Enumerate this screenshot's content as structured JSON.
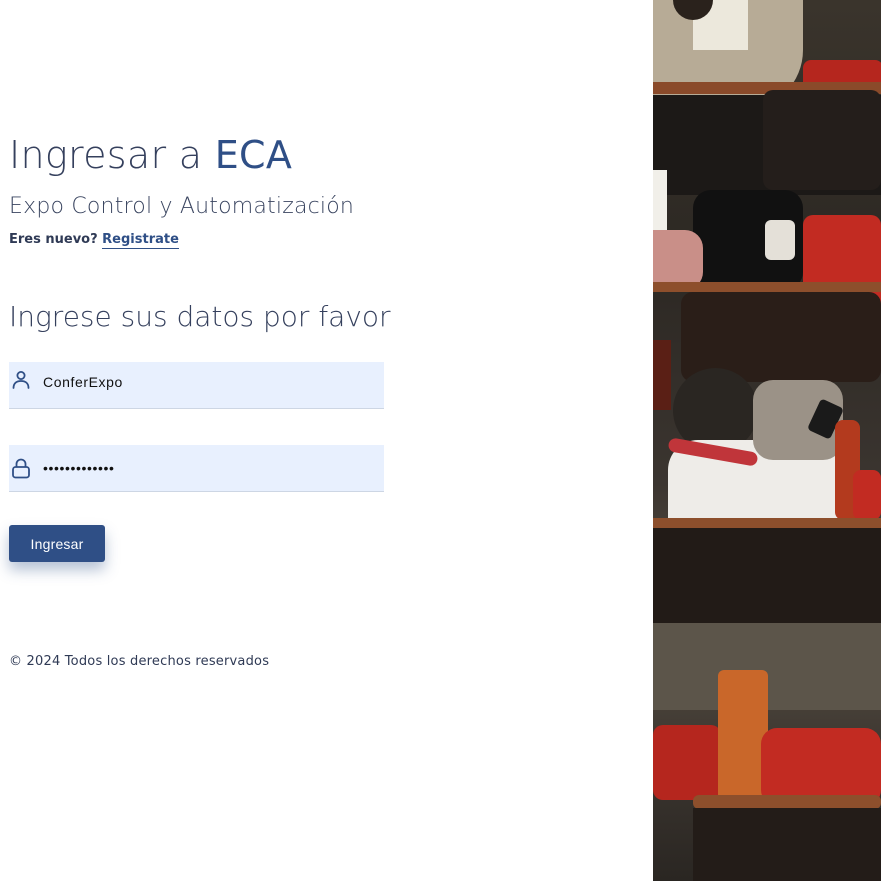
{
  "login": {
    "title_prefix": "Ingresar a ",
    "title_brand": "ECA",
    "subtitle": "Expo Control y Automatización",
    "register_prompt": "Eres nuevo? ",
    "register_link": "Registrate",
    "form_heading": "Ingrese sus datos por favor",
    "username": {
      "icon": "user-icon",
      "value": "ConferExpo"
    },
    "password": {
      "icon": "lock-icon",
      "value": "•••••••••••••"
    },
    "submit_label": "Ingresar",
    "footer": "© 2024 Todos los derechos reservados"
  },
  "colors": {
    "brand": "#2f4f86",
    "text": "#35405d",
    "input_bg": "#e8f0fe",
    "seat_red": "#b5261e"
  }
}
